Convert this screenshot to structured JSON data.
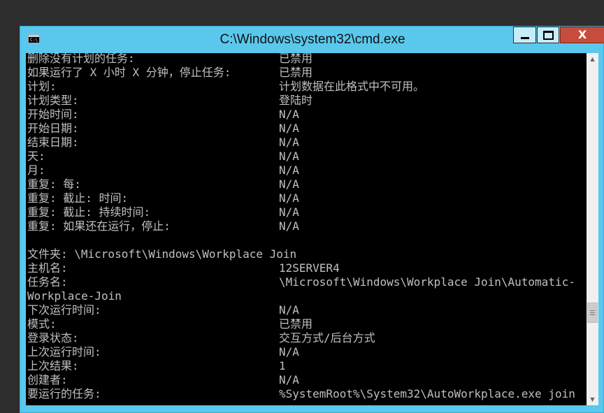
{
  "window": {
    "title": "C:\\Windows\\system32\\cmd.exe",
    "app_icon_text": "C:\\",
    "close_glyph": "X"
  },
  "console_lines": [
    {
      "label": "删除没有计划的任务:",
      "value": "已禁用"
    },
    {
      "label": "如果运行了 X 小时 X 分钟，停止任务:",
      "value": "已禁用"
    },
    {
      "label": "计划:",
      "value": "计划数据在此格式中不可用。"
    },
    {
      "label": "计划类型:",
      "value": "登陆时"
    },
    {
      "label": "开始时间:",
      "value": "N/A"
    },
    {
      "label": "开始日期:",
      "value": "N/A"
    },
    {
      "label": "结束日期:",
      "value": "N/A"
    },
    {
      "label": "天:",
      "value": "N/A"
    },
    {
      "label": "月:",
      "value": "N/A"
    },
    {
      "label": "重复: 每:",
      "value": "N/A"
    },
    {
      "label": "重复: 截止: 时间:",
      "value": "N/A"
    },
    {
      "label": "重复: 截止: 持续时间:",
      "value": "N/A"
    },
    {
      "label": "重复: 如果还在运行，停止:",
      "value": "N/A"
    },
    {
      "label": "",
      "value": ""
    },
    {
      "label": "文件夹: \\Microsoft\\Windows\\Workplace Join",
      "value": ""
    },
    {
      "label": "主机名:",
      "value": "12SERVER4"
    },
    {
      "label": "任务名:",
      "value": "\\Microsoft\\Windows\\Workplace Join\\Automatic-"
    },
    {
      "label": "Workplace-Join",
      "value": ""
    },
    {
      "label": "下次运行时间:",
      "value": "N/A"
    },
    {
      "label": "模式:",
      "value": "已禁用"
    },
    {
      "label": "登录状态:",
      "value": "交互方式/后台方式"
    },
    {
      "label": "上次运行时间:",
      "value": "N/A"
    },
    {
      "label": "上次结果:",
      "value": "1"
    },
    {
      "label": "创建者:",
      "value": "N/A"
    },
    {
      "label": "要运行的任务:",
      "value": "%SystemRoot%\\System32\\AutoWorkplace.exe join"
    }
  ],
  "icons": {
    "minimize": "minimize-icon",
    "maximize": "maximize-icon",
    "close": "close-icon",
    "scroll_up": "scroll-up-arrow-icon",
    "scroll_down": "scroll-down-arrow-icon"
  },
  "colors": {
    "titlebar": "#5ac8ed",
    "console_bg": "#000000",
    "console_text": "#c0c0c0",
    "close_button": "#c74c3c"
  }
}
